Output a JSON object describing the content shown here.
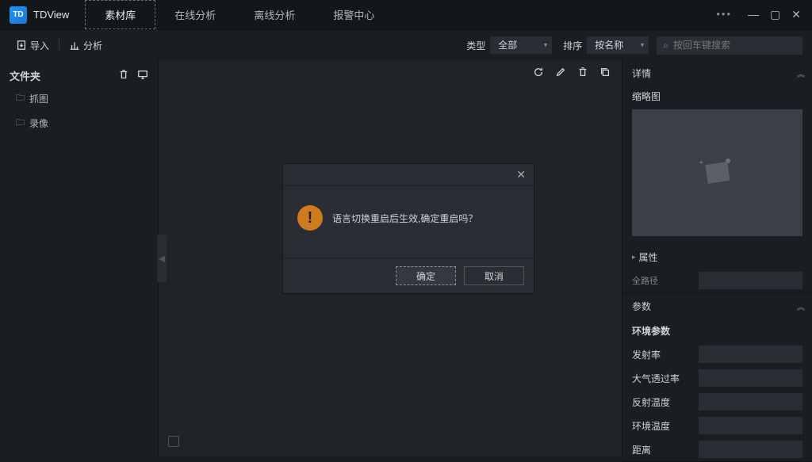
{
  "app": {
    "title": "TDView",
    "logo_text": "TD"
  },
  "tabs": [
    {
      "label": "素材库",
      "active": true
    },
    {
      "label": "在线分析",
      "active": false
    },
    {
      "label": "离线分析",
      "active": false
    },
    {
      "label": "报警中心",
      "active": false
    }
  ],
  "toolbar": {
    "import": "导入",
    "analysis": "分析",
    "type_label": "类型",
    "type_value": "全部",
    "sort_label": "排序",
    "sort_value": "按名称",
    "search_placeholder": "按回车键搜索"
  },
  "sidebar_left": {
    "title": "文件夹",
    "folders": [
      {
        "label": "抓图"
      },
      {
        "label": "录像"
      }
    ]
  },
  "details": {
    "header": "详情",
    "thumbnail_label": "缩略图",
    "attributes_label": "属性",
    "full_path_label": "全路径",
    "params": {
      "header": "参数",
      "env_header": "环境参数",
      "rows": [
        {
          "label": "发射率"
        },
        {
          "label": "大气透过率"
        },
        {
          "label": "反射温度"
        },
        {
          "label": "环境温度"
        },
        {
          "label": "距离"
        }
      ]
    }
  },
  "modal": {
    "message": "语言切换重启后生效,确定重启吗？",
    "ok": "确定",
    "cancel": "取消"
  }
}
